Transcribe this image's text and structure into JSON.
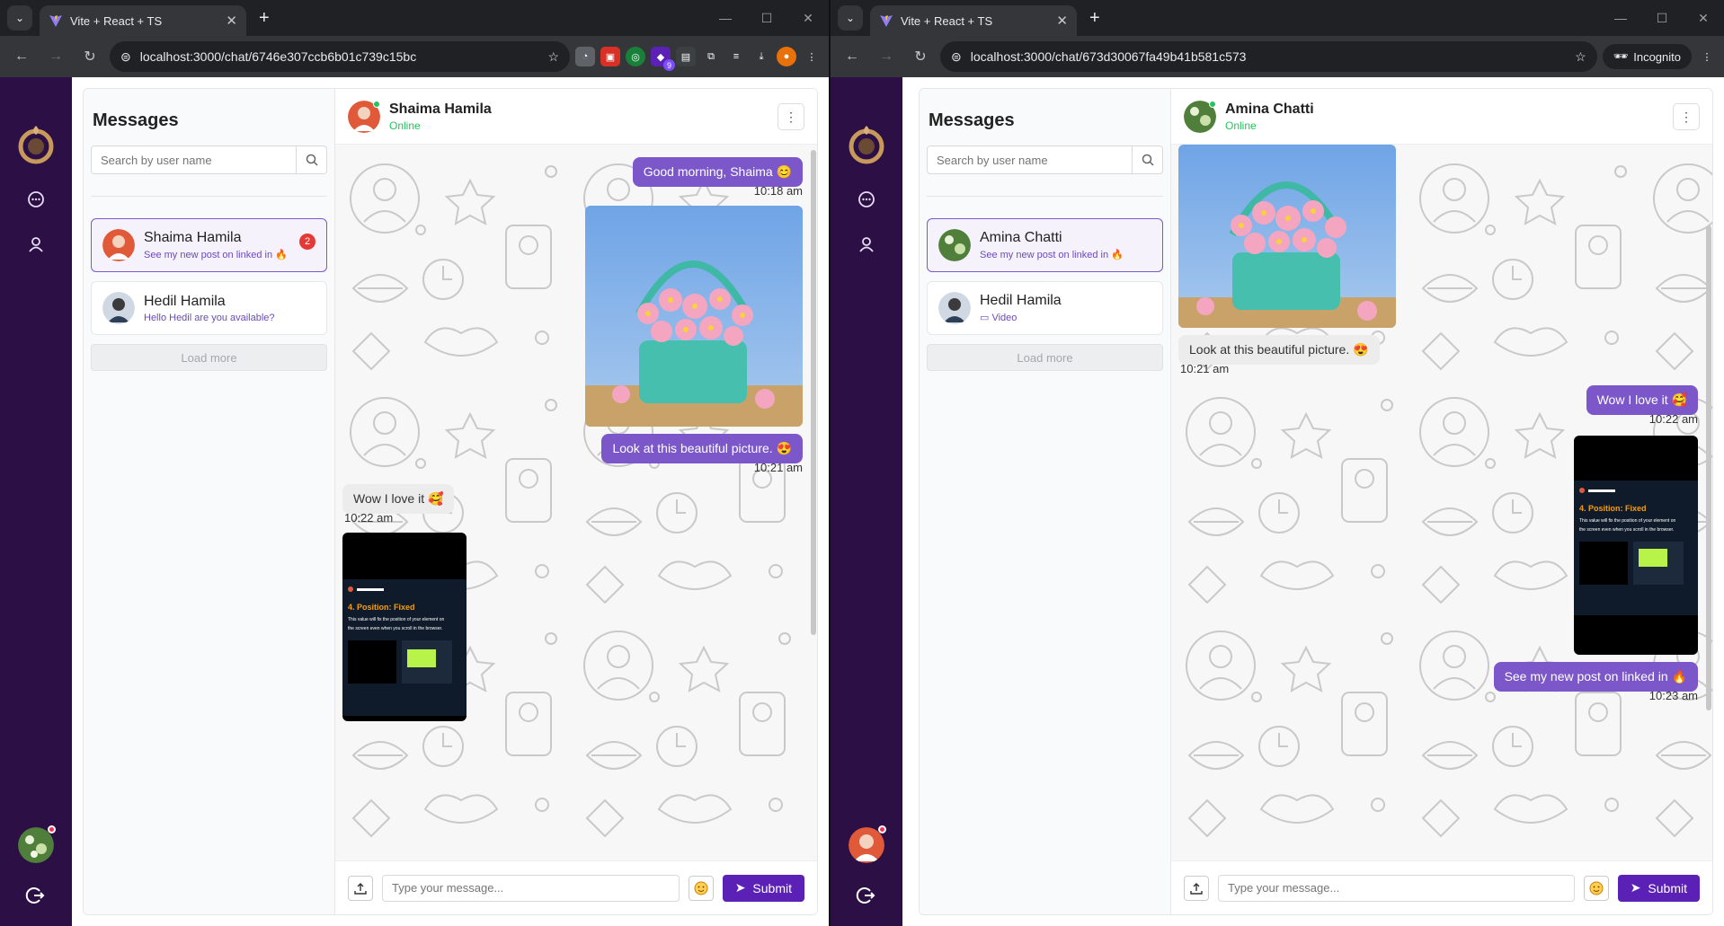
{
  "left": {
    "tab_title": "Vite + React + TS",
    "url": "localhost:3000/chat/6746e307ccb6b01c739c15bc",
    "ext_badge": "9",
    "sidebar_title": "Messages",
    "search_placeholder": "Search by user name",
    "conversations": [
      {
        "name": "Shaima Hamila",
        "preview": "See my new post on linked in 🔥",
        "badge": "2"
      },
      {
        "name": "Hedil Hamila",
        "preview": "Hello Hedil are you available?"
      }
    ],
    "load_more": "Load more",
    "header": {
      "name": "Shaima Hamila",
      "status": "Online"
    },
    "messages": [
      {
        "text": "Good morning, Shaima 😊",
        "time": "10:18 am"
      },
      {
        "text": "Look at this beautiful picture. 😍",
        "time": "10:21 am"
      },
      {
        "text": "Wow I love it 🥰",
        "time": "10:22 am"
      }
    ],
    "video_card": {
      "heading": "4. Position: Fixed",
      "line1": "This value will fix the position of your element on",
      "line2": "the screen even when you scroll in the browser."
    },
    "composer": {
      "placeholder": "Type your message...",
      "submit": "Submit"
    }
  },
  "right": {
    "tab_title": "Vite + React + TS",
    "url": "localhost:3000/chat/673d30067fa49b41b581c573",
    "incognito": "Incognito",
    "sidebar_title": "Messages",
    "search_placeholder": "Search by user name",
    "conversations": [
      {
        "name": "Amina Chatti",
        "preview": "See my new post on linked in 🔥"
      },
      {
        "name": "Hedil Hamila",
        "preview": "Video"
      }
    ],
    "load_more": "Load more",
    "header": {
      "name": "Amina Chatti",
      "status": "Online"
    },
    "messages": [
      {
        "text": "Look at this beautiful picture. 😍",
        "time": "10:21 am"
      },
      {
        "text": "Wow I love it 🥰",
        "time": "10:22 am"
      },
      {
        "text": "See my new post on linked in 🔥",
        "time": "10:23 am"
      }
    ],
    "video_card": {
      "heading": "4. Position: Fixed",
      "line1": "This value will fix the position of your element on",
      "line2": "the screen even when you scroll in the browser."
    },
    "composer": {
      "placeholder": "Type your message...",
      "submit": "Submit"
    }
  },
  "colors": {
    "accent": "#7b57c9",
    "rail": "#2b0f45",
    "submit": "#5b21b6",
    "online": "#22c55e",
    "badge": "#e53935"
  }
}
